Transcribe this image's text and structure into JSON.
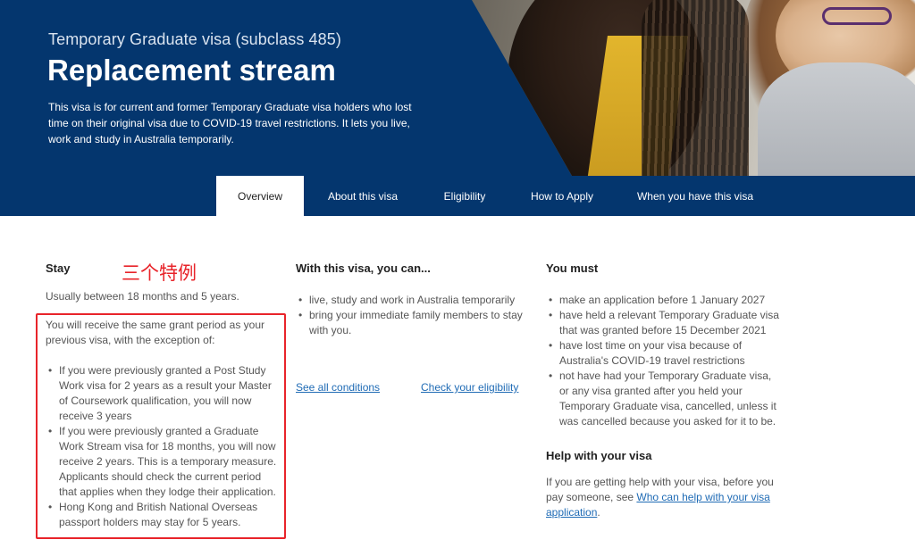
{
  "hero": {
    "subtitle": "Temporary Graduate visa (subclass 485)",
    "title": "Replacement stream",
    "intro": "This visa is for current and former Temporary Graduate visa holders who lost time on their original visa due to COVID-19 travel restrictions. It lets you live, work and study in Australia temporarily."
  },
  "tabs": [
    {
      "label": "Overview",
      "active": true
    },
    {
      "label": "About this visa",
      "active": false
    },
    {
      "label": "Eligibility",
      "active": false
    },
    {
      "label": "How to Apply",
      "active": false
    },
    {
      "label": "When you have this visa",
      "active": false
    }
  ],
  "stay": {
    "heading": "Stay",
    "summary": "Usually between 18 months and 5 years.",
    "detail": "You will receive the same grant period as your previous visa, with the exception of:",
    "items": [
      "If you were previously granted a Post Study Work visa for 2 years as a result your Master of Coursework qualification, you will now receive 3 years",
      "If you were previously granted a Graduate Work Stream visa for 18 months, you will now receive 2 years. This is a temporary measure. Applicants should check the current period that applies when they lodge their application.",
      "Hong Kong and British National Overseas passport holders may stay for 5 years."
    ]
  },
  "annotation": {
    "text": "三个特例",
    "color": "#e8242a"
  },
  "can": {
    "heading": "With this visa, you can...",
    "items": [
      "live, study and work in Australia temporarily",
      "bring your immediate family members to stay with you."
    ],
    "link_conditions": "See all conditions",
    "link_eligibility": "Check your eligibility"
  },
  "must": {
    "heading": "You must",
    "items": [
      "make an application before 1 January 2027",
      "have held a relevant Temporary Graduate visa that was granted before 15 December 2021",
      "have lost time on your visa because of Australia's COVID-19 travel restrictions",
      "not have had your Temporary Graduate visa, or any visa granted after you held your Temporary Graduate visa, cancelled, unless it was cancelled because you asked for it to be."
    ]
  },
  "help": {
    "heading": "Help with your visa",
    "text_before": "If you are getting help with your visa, before you pay someone, see ",
    "link": "Who can help with your visa application",
    "text_after": "."
  },
  "colors": {
    "hero_blue": "#04366e",
    "tab_bar": "#04366e",
    "link": "#1f6bb5",
    "annotation_red": "#e8242a"
  }
}
